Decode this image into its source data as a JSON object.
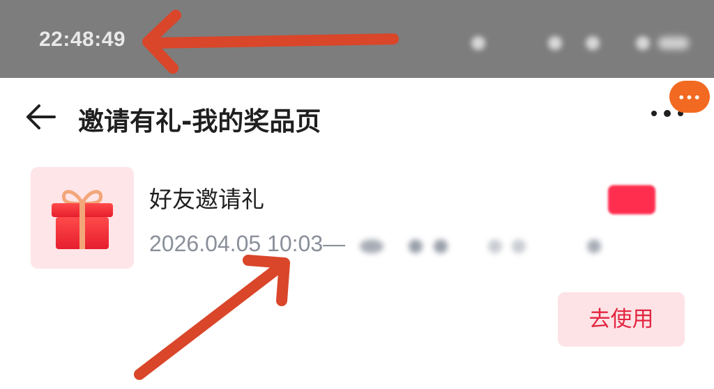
{
  "status_bar": {
    "time": "22:48:49"
  },
  "header": {
    "title": "邀请有礼-我的奖品页",
    "back_icon": "arrow-left-icon",
    "more_icon": "more-dots-icon",
    "badge_icon": "ellipsis-icon"
  },
  "reward": {
    "name": "好友邀请礼",
    "period": "2026.04.05 10:03—",
    "icon": "gift-icon",
    "use_label": "去使用"
  },
  "colors": {
    "status_bar_bg": "#7d7d7d",
    "accent_red": "#e4253f",
    "button_bg": "#fde3e6",
    "badge_orange": "#f26a21",
    "annotation_arrow": "#d9462a"
  }
}
